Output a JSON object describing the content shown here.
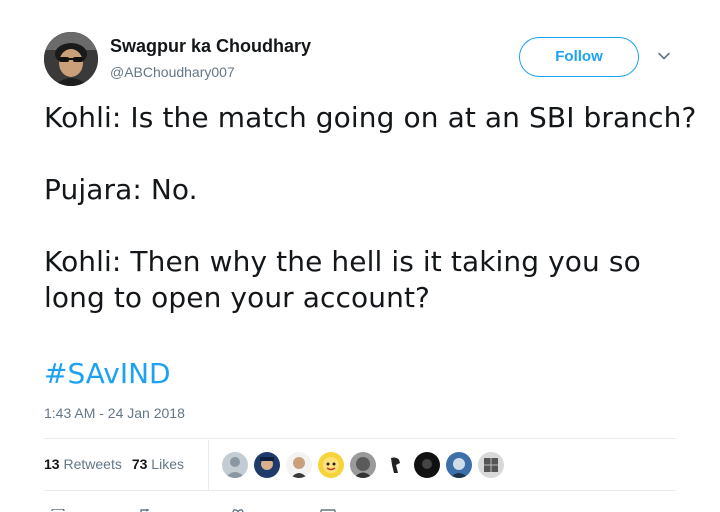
{
  "author": {
    "name": "Swagpur ka Choudhary",
    "handle": "@ABChoudhary007"
  },
  "follow_label": "Follow",
  "tweet": {
    "lines": [
      "Kohli: Is the match going on at an SBI branch?",
      "Pujara: No.",
      "Kohli: Then why the hell is it taking you so",
      "long to open your account?"
    ],
    "hashtag": "#SAvIND",
    "timestamp": "1:43 AM - 24 Jan 2018"
  },
  "stats": {
    "retweets_count": "13",
    "retweets_label": "Retweets",
    "likes_count": "73",
    "likes_label": "Likes"
  },
  "colors": {
    "accent": "#1da1f2",
    "text": "#14171a",
    "secondary": "#657786",
    "border": "#e6ecf0"
  },
  "icons": {
    "caret": "chevron-down-icon",
    "reply": "reply-icon",
    "retweet": "retweet-icon",
    "like": "heart-icon",
    "message": "envelope-icon"
  }
}
